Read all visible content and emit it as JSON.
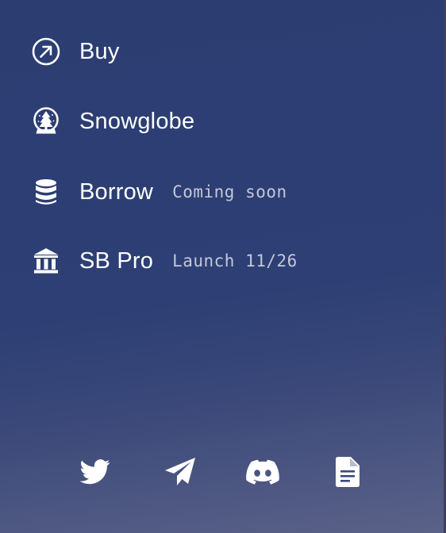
{
  "menu": {
    "items": [
      {
        "label": "Buy",
        "icon": "arrow-up-right-circle-icon"
      },
      {
        "label": "Snowglobe",
        "icon": "snowglobe-icon"
      },
      {
        "label": "Borrow",
        "note": "Coming soon",
        "icon": "database-stack-icon"
      },
      {
        "label": "SB Pro",
        "note": "Launch 11/26",
        "icon": "bank-building-icon"
      }
    ]
  },
  "social": {
    "icons": [
      "twitter-icon",
      "telegram-icon",
      "discord-icon",
      "document-icon"
    ]
  },
  "colors": {
    "background_top": "#2c3d72",
    "background_bottom": "#5b6288",
    "text": "#ffffff",
    "note_text": "#c3c8d8"
  }
}
